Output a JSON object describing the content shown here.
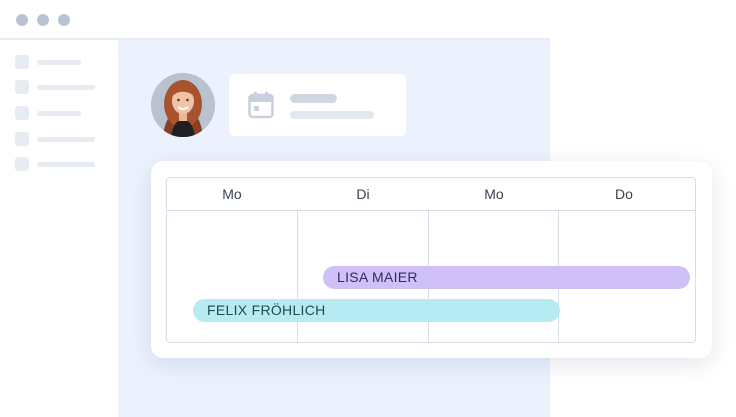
{
  "window": {
    "controls": [
      "dot",
      "dot",
      "dot"
    ]
  },
  "sidebar": {
    "items": [
      {
        "icon": "placeholder-square"
      },
      {
        "icon": "placeholder-square"
      },
      {
        "icon": "placeholder-square"
      },
      {
        "icon": "placeholder-square"
      },
      {
        "icon": "placeholder-square"
      }
    ]
  },
  "profile": {
    "avatar": "user-avatar",
    "info_icon": "calendar-icon"
  },
  "schedule": {
    "days": [
      "Mo",
      "Di",
      "Mo",
      "Do"
    ],
    "bookings": [
      {
        "name": "LISA MAIER",
        "color": "#cfc1f8"
      },
      {
        "name": "FELIX FRÖHLICH",
        "color": "#b6ebf3"
      }
    ]
  },
  "colors": {
    "content_bg": "#ebf2fe",
    "chrome_dot": "#b9c4d3",
    "grid_line": "#d7dde6"
  }
}
